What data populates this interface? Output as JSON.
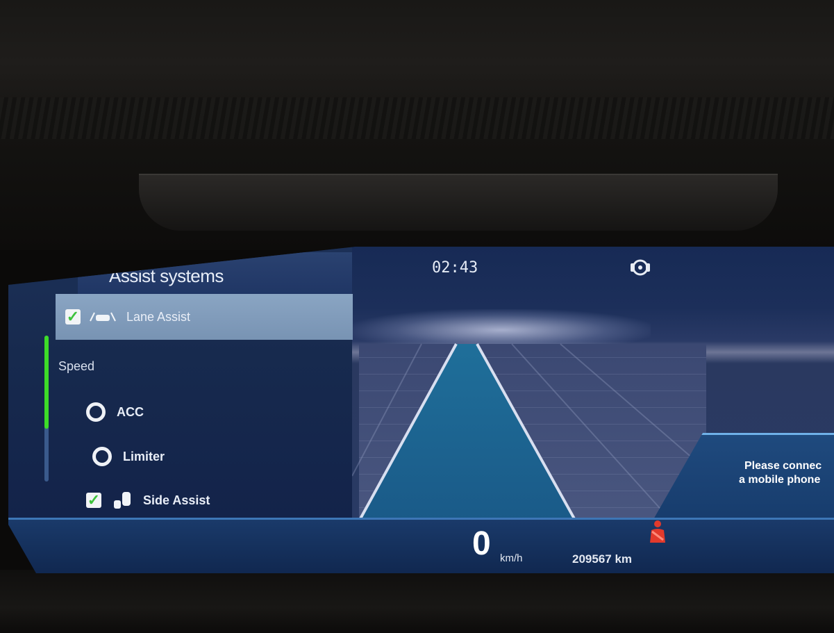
{
  "header": {
    "time": "02:43"
  },
  "panel": {
    "title": "Assist systems",
    "items": [
      {
        "label": "Lane Assist",
        "state": "checked",
        "selected": true,
        "icon": "lane-assist-icon"
      },
      {
        "label": "Speed",
        "type": "section"
      },
      {
        "label": "ACC",
        "state": "radio-off",
        "icon": "radio-icon"
      },
      {
        "label": "Limiter",
        "state": "radio-off",
        "icon": "radio-icon"
      },
      {
        "label": "Side Assist",
        "state": "checked",
        "icon": "side-assist-icon"
      }
    ],
    "speed_scroll_fraction": 0.64
  },
  "phone_prompt": {
    "line1": "Please connec",
    "line2": "a mobile phone"
  },
  "status": {
    "speed": "0",
    "speed_unit": "km/h",
    "odometer": "209567 km"
  },
  "icons": {
    "top_right": "hands-on-wheel-icon",
    "warning": "seatbelt-warning-icon"
  },
  "colors": {
    "accent_green": "#3ddc28",
    "selection": "#8aa5c3",
    "warning_red": "#e23a2c"
  }
}
